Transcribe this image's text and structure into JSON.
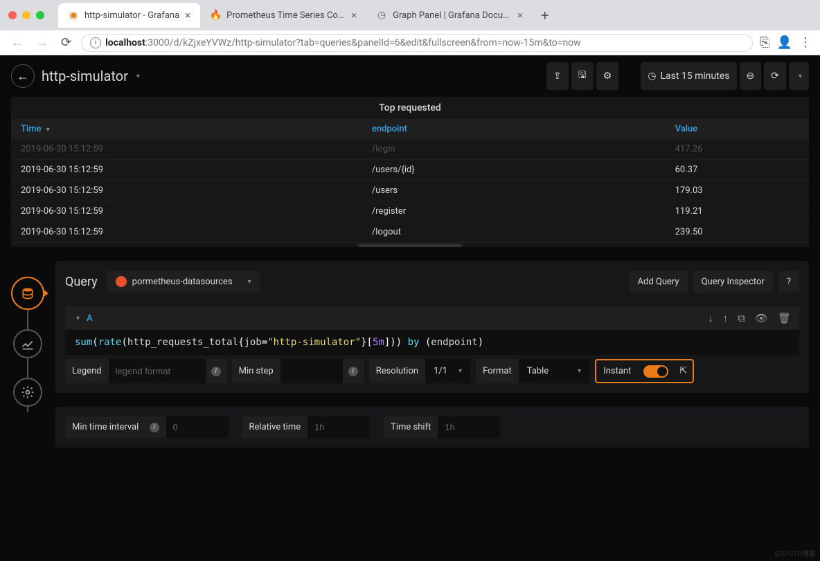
{
  "browser": {
    "tabs": [
      {
        "title": "http-simulator - Grafana",
        "active": true,
        "favicon": "grafana"
      },
      {
        "title": "Prometheus Time Series Colle",
        "active": false,
        "favicon": "prom"
      },
      {
        "title": "Graph Panel | Grafana Docume",
        "active": false,
        "favicon": "grafana-doc"
      }
    ],
    "url_host": "localhost",
    "url_path": ":3000/d/kZjxeYVWz/http-simulator?tab=queries&panelId=6&edit&fullscreen&from=now-15m&to=now"
  },
  "header": {
    "title": "http-simulator",
    "time_range": "Last 15 minutes"
  },
  "panel": {
    "title": "Top requested",
    "columns": [
      "Time",
      "endpoint",
      "Value"
    ],
    "rows": [
      {
        "time": "2019-06-30 15:12:59",
        "endpoint": "/login",
        "value": "417.26",
        "dim": true
      },
      {
        "time": "2019-06-30 15:12:59",
        "endpoint": "/users/{id}",
        "value": "60.37"
      },
      {
        "time": "2019-06-30 15:12:59",
        "endpoint": "/users",
        "value": "179.03"
      },
      {
        "time": "2019-06-30 15:12:59",
        "endpoint": "/register",
        "value": "119.21"
      },
      {
        "time": "2019-06-30 15:12:59",
        "endpoint": "/logout",
        "value": "239.50"
      }
    ]
  },
  "query": {
    "section_label": "Query",
    "datasource": "pormetheus-datasources",
    "add_query": "Add Query",
    "inspector": "Query Inspector",
    "help": "?",
    "letter": "A",
    "expression_tokens": [
      {
        "t": "kw",
        "v": "sum"
      },
      {
        "t": "br",
        "v": "("
      },
      {
        "t": "kw",
        "v": "rate"
      },
      {
        "t": "br",
        "v": "("
      },
      {
        "t": "plain",
        "v": "http_requests_total"
      },
      {
        "t": "br",
        "v": "{"
      },
      {
        "t": "plain",
        "v": "job"
      },
      {
        "t": "br",
        "v": "="
      },
      {
        "t": "str",
        "v": "\"http-simulator\""
      },
      {
        "t": "br",
        "v": "}"
      },
      {
        "t": "br",
        "v": "["
      },
      {
        "t": "num",
        "v": "5m"
      },
      {
        "t": "br",
        "v": "]"
      },
      {
        "t": "br",
        "v": ")"
      },
      {
        "t": "br",
        "v": ")"
      },
      {
        "t": "plain",
        "v": " "
      },
      {
        "t": "kw",
        "v": "by"
      },
      {
        "t": "plain",
        "v": " "
      },
      {
        "t": "br",
        "v": "("
      },
      {
        "t": "plain",
        "v": "endpoint"
      },
      {
        "t": "br",
        "v": ")"
      }
    ],
    "legend_label": "Legend",
    "legend_placeholder": "legend format",
    "minstep_label": "Min step",
    "resolution_label": "Resolution",
    "resolution_value": "1/1",
    "format_label": "Format",
    "format_value": "Table",
    "instant_label": "Instant"
  },
  "timeopts": {
    "min_interval_label": "Min time interval",
    "min_interval_placeholder": "0",
    "relative_label": "Relative time",
    "relative_placeholder": "1h",
    "shift_label": "Time shift",
    "shift_placeholder": "1h"
  },
  "watermark": "@51CTO博客"
}
